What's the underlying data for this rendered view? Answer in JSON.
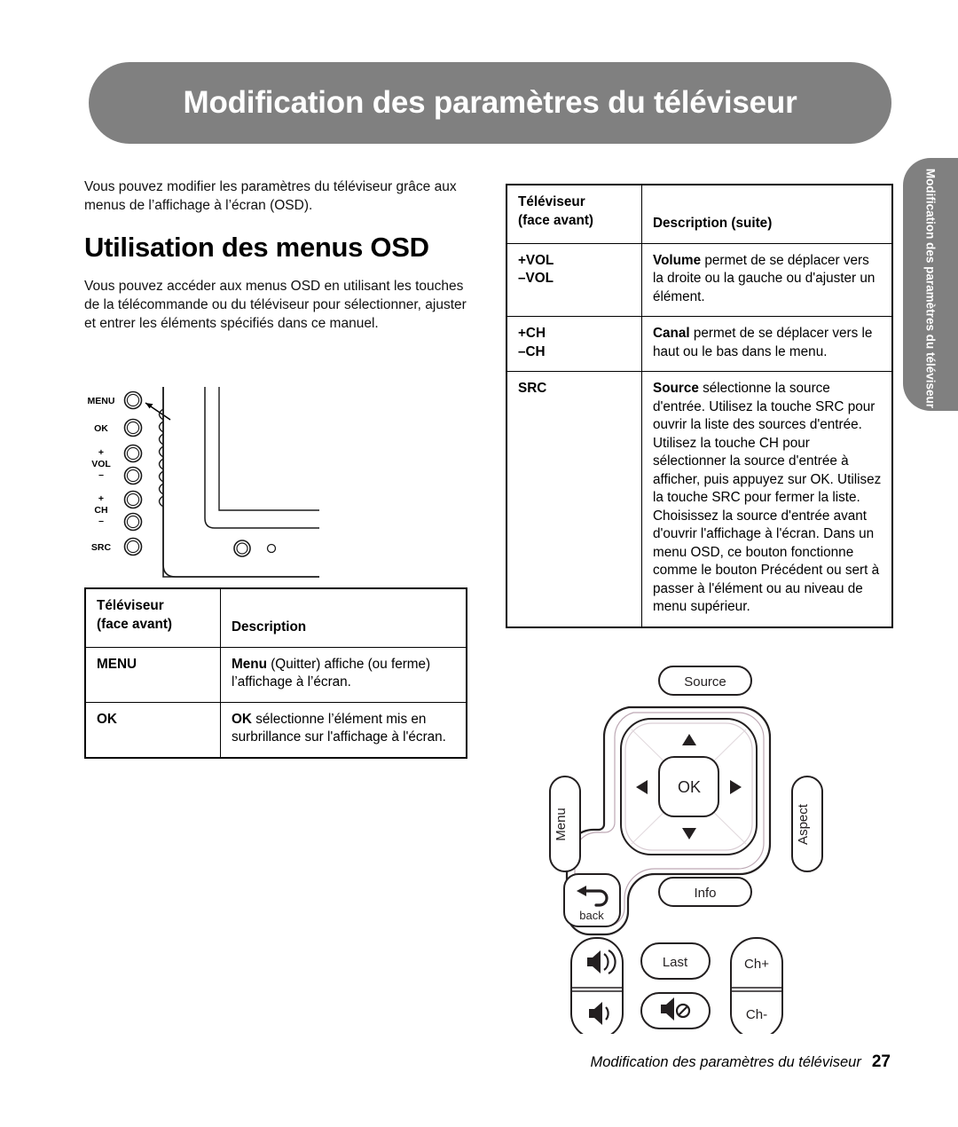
{
  "header": {
    "title": "Modification des paramètres du téléviseur"
  },
  "side_tab": {
    "text": "Modification des paramètres du téléviseur"
  },
  "left": {
    "intro": "Vous pouvez modifier les paramètres du téléviseur grâce aux menus de l’affichage à l’écran (OSD).",
    "section_title": "Utilisation des menus OSD",
    "body": "Vous pouvez accéder aux menus OSD en utilisant les touches de la télécommande ou du téléviseur pour sélectionner, ajuster et entrer les éléments spécifiés dans ce manuel."
  },
  "tv_diagram": {
    "labels": [
      "MENU",
      "OK",
      "+",
      "VOL",
      "–",
      "+",
      "CH",
      "–",
      "SRC"
    ],
    "button_names": [
      "menu",
      "ok",
      "vol-up",
      "vol-down",
      "ch-up",
      "ch-down",
      "src"
    ]
  },
  "table_left": {
    "headers": {
      "col1_line1": "Téléviseur",
      "col1_line2": "(face avant)",
      "col2": "Description"
    },
    "rows": [
      {
        "key": "MENU",
        "desc_bold": "Menu",
        "desc_rest": " (Quitter) affiche (ou ferme) l’affichage à l’écran."
      },
      {
        "key": "OK",
        "desc_bold": "OK",
        "desc_rest": " sélectionne l’élément mis en surbrillance sur l'affichage à l'écran."
      }
    ]
  },
  "table_right": {
    "headers": {
      "col1_line1": "Téléviseur",
      "col1_line2": "(face avant)",
      "col2": "Description (suite)"
    },
    "rows": [
      {
        "key_line1": "+VOL",
        "key_line2": "–VOL",
        "desc_bold": "Volume",
        "desc_rest": " permet de se déplacer vers la droite ou la gauche ou d'ajuster un élément."
      },
      {
        "key_line1": "+CH",
        "key_line2": "–CH",
        "desc_bold": "Canal",
        "desc_rest": " permet de se déplacer vers le haut ou le bas dans le menu."
      },
      {
        "key_line1": "SRC",
        "key_line2": "",
        "desc_bold": "Source",
        "desc_rest": " sélectionne la source d'entrée. Utilisez la touche SRC pour ouvrir la liste des sources d'entrée. Utilisez la touche CH pour sélectionner la source d'entrée à afficher, puis appuyez sur OK. Utilisez la touche SRC pour fermer la liste. Choisissez la source d'entrée avant d'ouvrir l'affichage à l'écran. Dans un menu OSD, ce bouton fonctionne comme le bouton Précédent ou sert à passer à l'élément ou au niveau de menu supérieur."
      }
    ]
  },
  "remote": {
    "source_label": "Source",
    "menu_label": "Menu",
    "aspect_label": "Aspect",
    "ok_label": "OK",
    "back_label": "back",
    "info_label": "Info",
    "last_label": "Last",
    "ch_up_label": "Ch+",
    "ch_down_label": "Ch-",
    "icons": {
      "up": "up-arrow-icon",
      "down": "down-arrow-icon",
      "left": "left-arrow-icon",
      "right": "right-arrow-icon",
      "back": "back-arrow-icon",
      "volume_up": "volume-up-icon",
      "volume_down": "volume-down-icon",
      "mute": "mute-icon"
    }
  },
  "footer": {
    "title": "Modification des paramètres du téléviseur",
    "page": "27"
  },
  "colors": {
    "banner_gray": "#808080",
    "text_black": "#000000",
    "page_white": "#ffffff"
  }
}
